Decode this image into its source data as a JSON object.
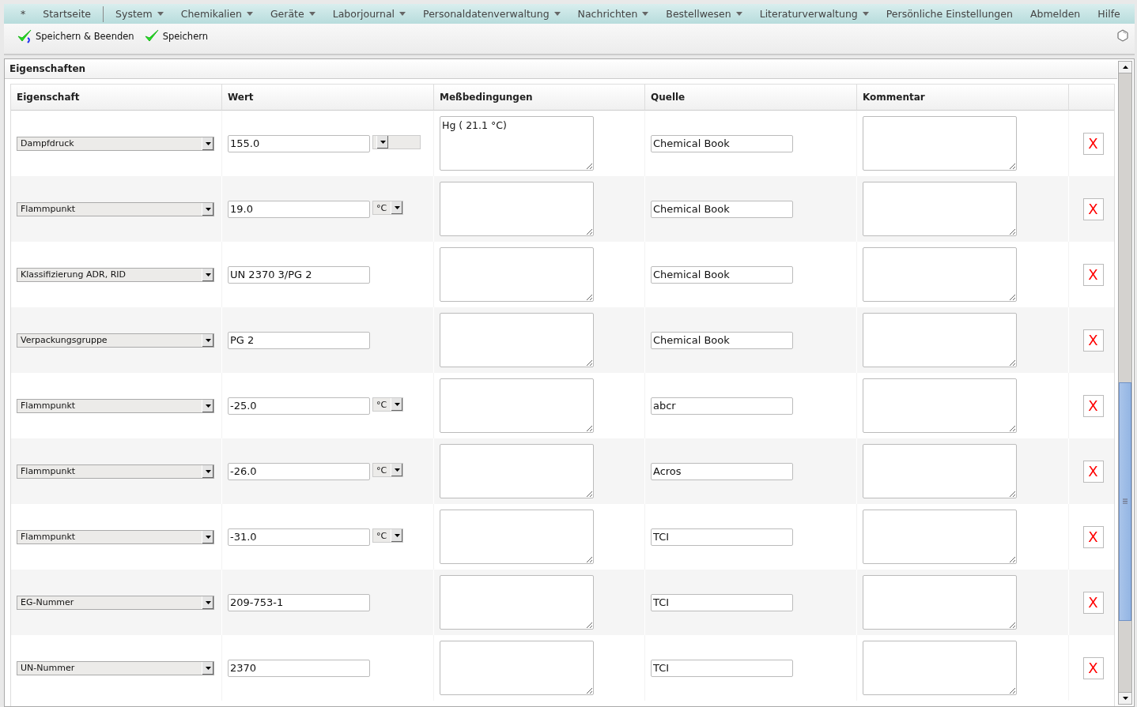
{
  "nav": [
    {
      "label": "*",
      "dropdown": false
    },
    {
      "label": "Startseite",
      "dropdown": false
    },
    {
      "kind": "separator"
    },
    {
      "label": "System",
      "dropdown": true
    },
    {
      "label": "Chemikalien",
      "dropdown": true
    },
    {
      "label": "Geräte",
      "dropdown": true
    },
    {
      "label": "Laborjournal",
      "dropdown": true
    },
    {
      "label": "Personaldatenverwaltung",
      "dropdown": true
    },
    {
      "label": "Nachrichten",
      "dropdown": true
    },
    {
      "label": "Bestellwesen",
      "dropdown": true
    },
    {
      "label": "Literaturverwaltung",
      "dropdown": true
    },
    {
      "label": "Persönliche Einstellungen",
      "dropdown": false
    },
    {
      "label": "Abmelden",
      "dropdown": false
    },
    {
      "label": "Hilfe",
      "dropdown": false
    }
  ],
  "toolbar": [
    {
      "label": "Speichern & Beenden",
      "kind": "save-close"
    },
    {
      "label": "Speichern",
      "kind": "save"
    }
  ],
  "panel": {
    "title": "Eigenschaften",
    "columns": [
      "Eigenschaft",
      "Wert",
      "Meßbedingungen",
      "Quelle",
      "Kommentar"
    ],
    "rows": [
      {
        "kind": "measured",
        "property": "Dampfdruck",
        "value": "155.0",
        "conditions": "Hg ( 21.1 °C)",
        "source": "Chemical Book",
        "delete": "X"
      },
      {
        "kind": "measured",
        "property": "Flammpunkt",
        "value": "19.0",
        "unit": "°C",
        "source": "Chemical Book",
        "delete": "X"
      },
      {
        "kind": "plain",
        "property": "Klassifizierung ADR, RID",
        "value": "UN 2370 3/PG 2",
        "source": "Chemical Book",
        "delete": "X"
      },
      {
        "kind": "plain",
        "property": "Verpackungsgruppe",
        "value": "PG 2",
        "source": "Chemical Book",
        "delete": "X"
      },
      {
        "kind": "measured",
        "property": "Flammpunkt",
        "value": "-25.0",
        "unit": "°C",
        "source": "abcr",
        "delete": "X"
      },
      {
        "kind": "measured",
        "property": "Flammpunkt",
        "value": "-26.0",
        "unit": "°C",
        "source": "Acros",
        "delete": "X"
      },
      {
        "kind": "measured",
        "property": "Flammpunkt",
        "value": "-31.0",
        "unit": "°C",
        "source": "TCI",
        "delete": "X"
      },
      {
        "kind": "plain",
        "property": "EG-Nummer",
        "value": "209-753-1",
        "source": "TCI",
        "delete": "X"
      },
      {
        "kind": "plain",
        "property": "UN-Nummer",
        "value": "2370",
        "source": "TCI",
        "delete": "X"
      }
    ]
  }
}
